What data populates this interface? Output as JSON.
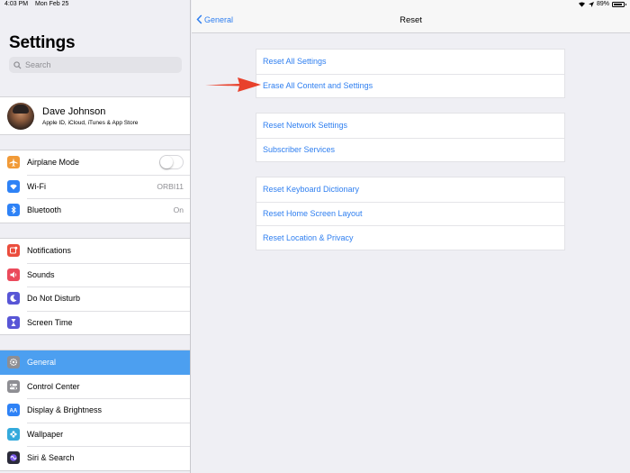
{
  "status": {
    "time": "4:03 PM",
    "date": "Mon Feb 25",
    "battery": "89%"
  },
  "sidebar": {
    "title": "Settings",
    "search_placeholder": "Search",
    "profile": {
      "name": "Dave Johnson",
      "subtitle": "Apple ID, iCloud, iTunes & App Store"
    },
    "group1": [
      {
        "label": "Airplane Mode",
        "icon": "airplane-icon",
        "color": "#f19a37",
        "toggle": false
      },
      {
        "label": "Wi-Fi",
        "icon": "wifi-icon",
        "color": "#2e82f6",
        "value": "ORBI11"
      },
      {
        "label": "Bluetooth",
        "icon": "bluetooth-icon",
        "color": "#2e82f6",
        "value": "On"
      }
    ],
    "group2": [
      {
        "label": "Notifications",
        "icon": "notifications-icon",
        "color": "#eb4d3d"
      },
      {
        "label": "Sounds",
        "icon": "sounds-icon",
        "color": "#eb4a5b"
      },
      {
        "label": "Do Not Disturb",
        "icon": "moon-icon",
        "color": "#5856d6"
      },
      {
        "label": "Screen Time",
        "icon": "hourglass-icon",
        "color": "#5856d6"
      }
    ],
    "group3": [
      {
        "label": "General",
        "icon": "gear-icon",
        "color": "#8e8e93",
        "selected": true
      },
      {
        "label": "Control Center",
        "icon": "switches-icon",
        "color": "#8e8e93"
      },
      {
        "label": "Display & Brightness",
        "icon": "text-size-icon",
        "color": "#2e82f6"
      },
      {
        "label": "Wallpaper",
        "icon": "flower-icon",
        "color": "#34aadc"
      },
      {
        "label": "Siri & Search",
        "icon": "siri-icon",
        "color": "#2b2b3a"
      }
    ]
  },
  "nav": {
    "back_label": "General",
    "title": "Reset"
  },
  "reset_groups": [
    [
      "Reset All Settings",
      "Erase All Content and Settings"
    ],
    [
      "Reset Network Settings",
      "Subscriber Services"
    ],
    [
      "Reset Keyboard Dictionary",
      "Reset Home Screen Layout",
      "Reset Location & Privacy"
    ]
  ],
  "colors": {
    "accent": "#2f7ff0",
    "selected_row": "#4c9ff0",
    "arrow": "#e8412c"
  }
}
